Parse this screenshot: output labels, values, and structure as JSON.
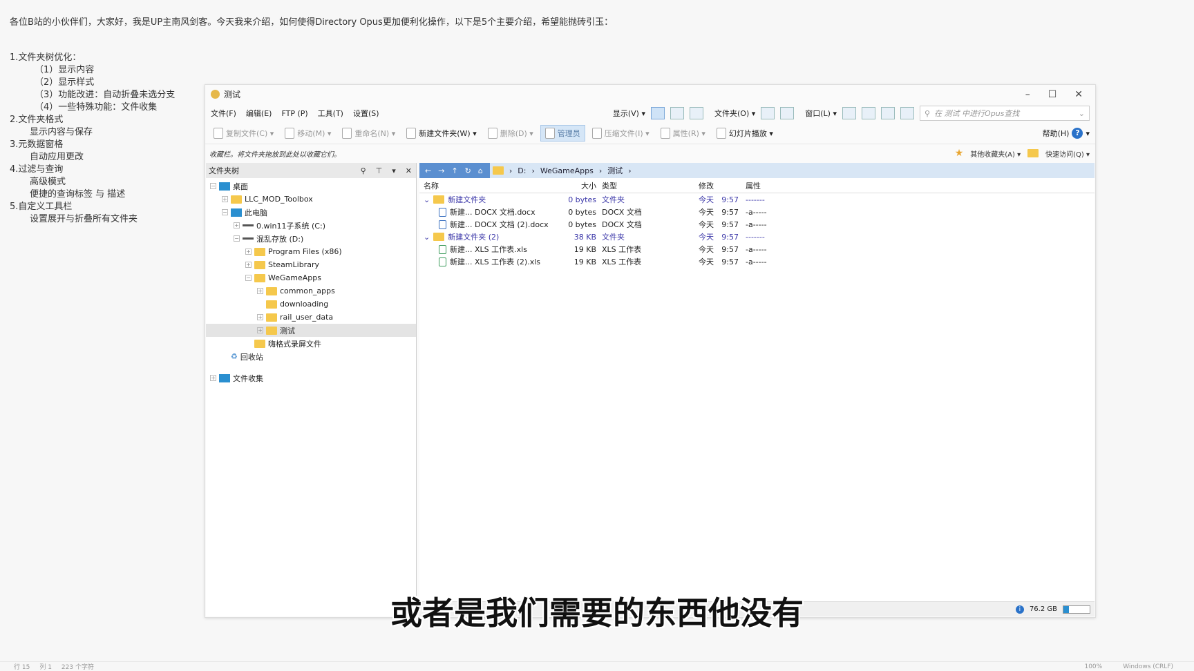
{
  "intro": "各位B站的小伙伴们，大家好，我是UP主南风剑客。今天我来介绍，如何使得Directory Opus更加便利化操作，以下是5个主要介绍，希望能抛砖引玉：",
  "outline": [
    {
      "t": "1.文件夹树优化：",
      "lv": 1
    },
    {
      "t": "（1）显示内容",
      "lv": 2
    },
    {
      "t": "（2）显示样式",
      "lv": 2
    },
    {
      "t": "（3）功能改进：自动折叠未选分支",
      "lv": 2
    },
    {
      "t": "（4）一些特殊功能：文件收集",
      "lv": 2
    },
    {
      "t": "2.文件夹格式",
      "lv": 1
    },
    {
      "t": "显示内容与保存",
      "lv": 3
    },
    {
      "t": "3.元数据窗格",
      "lv": 1
    },
    {
      "t": "自动应用更改",
      "lv": 3
    },
    {
      "t": "4.过滤与查询",
      "lv": 1
    },
    {
      "t": "高级模式",
      "lv": 3
    },
    {
      "t": "便捷的查询标签 与 描述",
      "lv": 3
    },
    {
      "t": "5.自定义工具栏",
      "lv": 1
    },
    {
      "t": "设置展开与折叠所有文件夹",
      "lv": 3
    }
  ],
  "window": {
    "title": "测试",
    "min": "–",
    "max": "☐",
    "close": "✕"
  },
  "menu": [
    "文件(F)",
    "编辑(E)",
    "FTP (P)",
    "工具(T)",
    "设置(S)"
  ],
  "menu_right": {
    "display": "显示(V) ▾",
    "folder": "文件夹(O) ▾",
    "window": "窗口(L) ▾",
    "search_placeholder": "在 测试 中进行Opus查找"
  },
  "toolbar": [
    {
      "label": "复制文件(C) ▾",
      "cls": ""
    },
    {
      "label": "移动(M) ▾",
      "cls": ""
    },
    {
      "label": "重命名(N) ▾",
      "cls": ""
    },
    {
      "label": "新建文件夹(W) ▾",
      "cls": "dark"
    },
    {
      "label": "删除(D) ▾",
      "cls": ""
    },
    {
      "label": "管理员",
      "cls": "sel"
    },
    {
      "label": "压缩文件(I) ▾",
      "cls": ""
    },
    {
      "label": "属性(R) ▾",
      "cls": ""
    },
    {
      "label": "幻灯片播放 ▾",
      "cls": "dark"
    }
  ],
  "help": "帮助(H)",
  "favbar": {
    "hint": "收藏栏。将文件夹拖放到此处以收藏它们。",
    "other": "其他收藏夹(A) ▾",
    "quick": "快速访问(Q) ▾"
  },
  "tree": {
    "title": "文件夹树",
    "nodes": [
      {
        "t": "桌面",
        "d": 0,
        "i": "pc",
        "pm": "−"
      },
      {
        "t": "LLC_MOD_Toolbox",
        "d": 1,
        "i": "fold",
        "pm": "+"
      },
      {
        "t": "此电脑",
        "d": 1,
        "i": "pc",
        "pm": "−"
      },
      {
        "t": "0.win11子系统 (C:)",
        "d": 2,
        "i": "drive",
        "pm": "+"
      },
      {
        "t": "混乱存放 (D:)",
        "d": 2,
        "i": "drive",
        "pm": "−"
      },
      {
        "t": "Program Files (x86)",
        "d": 3,
        "i": "fold",
        "pm": "+"
      },
      {
        "t": "SteamLibrary",
        "d": 3,
        "i": "fold",
        "pm": "+"
      },
      {
        "t": "WeGameApps",
        "d": 3,
        "i": "fold",
        "pm": "−"
      },
      {
        "t": "common_apps",
        "d": 4,
        "i": "fold",
        "pm": "+"
      },
      {
        "t": "downloading",
        "d": 4,
        "i": "fold",
        "pm": ""
      },
      {
        "t": "rail_user_data",
        "d": 4,
        "i": "fold",
        "pm": "+"
      },
      {
        "t": "测试",
        "d": 4,
        "i": "fold",
        "pm": "+",
        "sel": true
      },
      {
        "t": "嗨格式录屏文件",
        "d": 3,
        "i": "fold",
        "pm": ""
      },
      {
        "t": "回收站",
        "d": 1,
        "i": "bin",
        "pm": ""
      },
      {
        "t": "文件收集",
        "d": 0,
        "i": "pc",
        "pm": "+",
        "gap": true
      }
    ]
  },
  "path": [
    "D:",
    "WeGameApps",
    "测试"
  ],
  "columns": [
    "名称",
    "大小",
    "类型",
    "修改",
    "",
    "属性"
  ],
  "rows": [
    {
      "name": "新建文件夹",
      "size": "0 bytes",
      "type": "文件夹",
      "day": "今天",
      "time": "9:57",
      "attr": "-------",
      "folder": true
    },
    {
      "name": "新建... DOCX 文档.docx",
      "size": "0 bytes",
      "type": "DOCX 文档",
      "day": "今天",
      "time": "9:57",
      "attr": "-a-----"
    },
    {
      "name": "新建... DOCX 文档 (2).docx",
      "size": "0 bytes",
      "type": "DOCX 文档",
      "day": "今天",
      "time": "9:57",
      "attr": "-a-----"
    },
    {
      "name": "新建文件夹 (2)",
      "size": "38 KB",
      "type": "文件夹",
      "day": "今天",
      "time": "9:57",
      "attr": "-------",
      "folder": true
    },
    {
      "name": "新建... XLS 工作表.xls",
      "size": "19 KB",
      "type": "XLS 工作表",
      "day": "今天",
      "time": "9:57",
      "attr": "-a-----"
    },
    {
      "name": "新建... XLS 工作表 (2).xls",
      "size": "19 KB",
      "type": "XLS 工作表",
      "day": "今天",
      "time": "9:57",
      "attr": "-a-----"
    }
  ],
  "status": {
    "free": "76.2 GB",
    "used_fraction": 0.2
  },
  "subtitle": "或者是我们需要的东西他没有",
  "bottom": {
    "left": [
      "行 15",
      "列 1",
      "223 个字符"
    ],
    "right": [
      "100%",
      "Windows (CRLF)"
    ]
  }
}
